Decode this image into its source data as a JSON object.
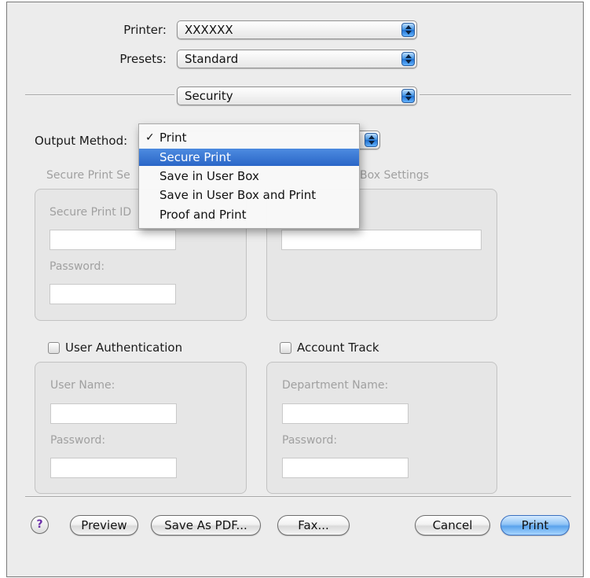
{
  "printer": {
    "label": "Printer:",
    "value": "XXXXXX"
  },
  "presets": {
    "label": "Presets:",
    "value": "Standard"
  },
  "pane": {
    "value": "Security"
  },
  "output_method": {
    "label": "Output Method:",
    "menu": [
      {
        "label": "Print",
        "checked": true
      },
      {
        "label": "Secure Print",
        "highlighted": true
      },
      {
        "label": "Save in User Box"
      },
      {
        "label": "Save in User Box and Print"
      },
      {
        "label": "Proof and Print"
      }
    ]
  },
  "secure_print_settings": {
    "title_visible": "Secure Print Se",
    "id_label_visible": "Secure Print ID",
    "password_label": "Password:"
  },
  "user_box_settings": {
    "title_visible": "Box Settings"
  },
  "user_authentication": {
    "checkbox_label": "User Authentication",
    "user_name_label": "User Name:",
    "password_label": "Password:"
  },
  "account_track": {
    "checkbox_label": "Account Track",
    "department_label": "Department Name:",
    "password_label": "Password:"
  },
  "buttons": {
    "help": "?",
    "preview": "Preview",
    "save_as_pdf": "Save As PDF...",
    "fax": "Fax...",
    "cancel": "Cancel",
    "print": "Print"
  },
  "colors": {
    "highlight": "#2a66c7",
    "default_button": "#5aa3ec",
    "background": "#ececec"
  }
}
